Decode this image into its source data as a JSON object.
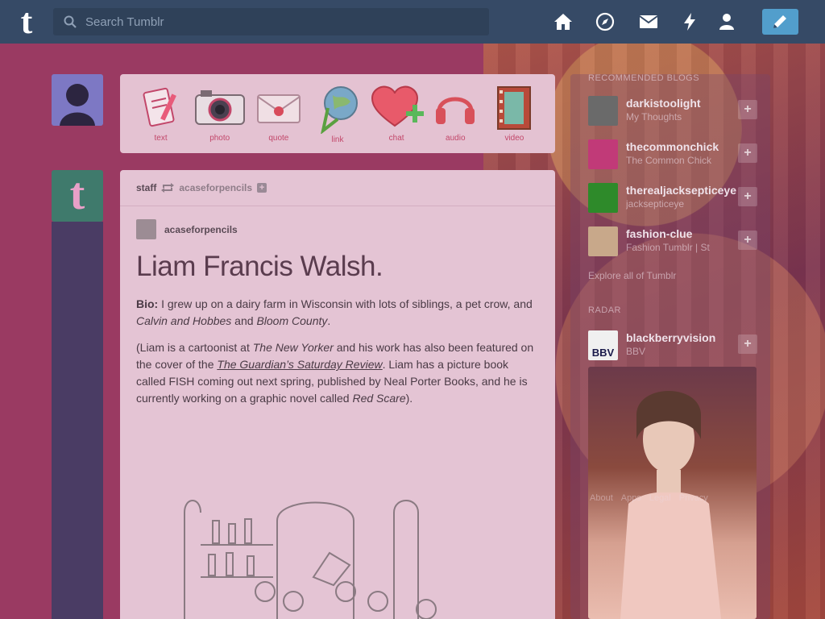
{
  "search": {
    "placeholder": "Search Tumblr"
  },
  "logo": "t",
  "nav": [
    "home-icon",
    "explore-icon",
    "inbox-icon",
    "activity-icon",
    "account-icon"
  ],
  "post_types": [
    {
      "label": "text",
      "icon": "text-icon"
    },
    {
      "label": "photo",
      "icon": "camera-icon"
    },
    {
      "label": "quote",
      "icon": "quote-icon"
    },
    {
      "label": "link",
      "icon": "link-icon"
    },
    {
      "label": "chat",
      "icon": "chat-icon"
    },
    {
      "label": "audio",
      "icon": "audio-icon"
    },
    {
      "label": "video",
      "icon": "video-icon"
    }
  ],
  "post": {
    "reblogger": "staff",
    "source": "acaseforpencils",
    "author": "acaseforpencils",
    "title": "Liam Francis Walsh.",
    "bio_label": "Bio:",
    "bio_text_1": " I grew up on a dairy farm in Wisconsin with lots of siblings, a pet crow, and ",
    "bio_em_1": "Calvin and Hobbes",
    "bio_text_2": " and ",
    "bio_em_2": "Bloom County",
    "bio_text_3": ".",
    "p2_1": "(Liam is a cartoonist at ",
    "p2_em_1": "The New Yorker",
    "p2_2": " and his work has also been featured on the cover of the ",
    "p2_link": "The Guardian’s Saturday Review",
    "p2_3": ". Liam has a picture book called FISH coming out next spring, published by Neal Porter Books, and he is currently working on a graphic novel called ",
    "p2_em_2": "Red Scare",
    "p2_4": ")."
  },
  "sidebar": {
    "recommended_heading": "RECOMMENDED BLOGS",
    "blogs": [
      {
        "name": "darkistoolight",
        "desc": "My Thoughts",
        "color": "#6a6a6a"
      },
      {
        "name": "thecommonchick",
        "desc": "The Common Chick",
        "color": "#c13a78"
      },
      {
        "name": "therealjacksepticeye",
        "desc": "jacksepticeye",
        "color": "#2e8a2a"
      },
      {
        "name": "fashion-clue",
        "desc": "Fashion Tumblr | St",
        "color": "#c8a88a"
      }
    ],
    "explore": "Explore all of Tumblr",
    "radar_heading": "RADAR",
    "radar_blog": {
      "name": "blackberryvision",
      "desc": "BBV",
      "logo": "BBV"
    },
    "footer": [
      "About",
      "Apps",
      "Legal",
      "Privacy"
    ]
  },
  "colors": {
    "topbar": "#364a66",
    "accent": "#529ecc",
    "background": "#9a3a62"
  }
}
